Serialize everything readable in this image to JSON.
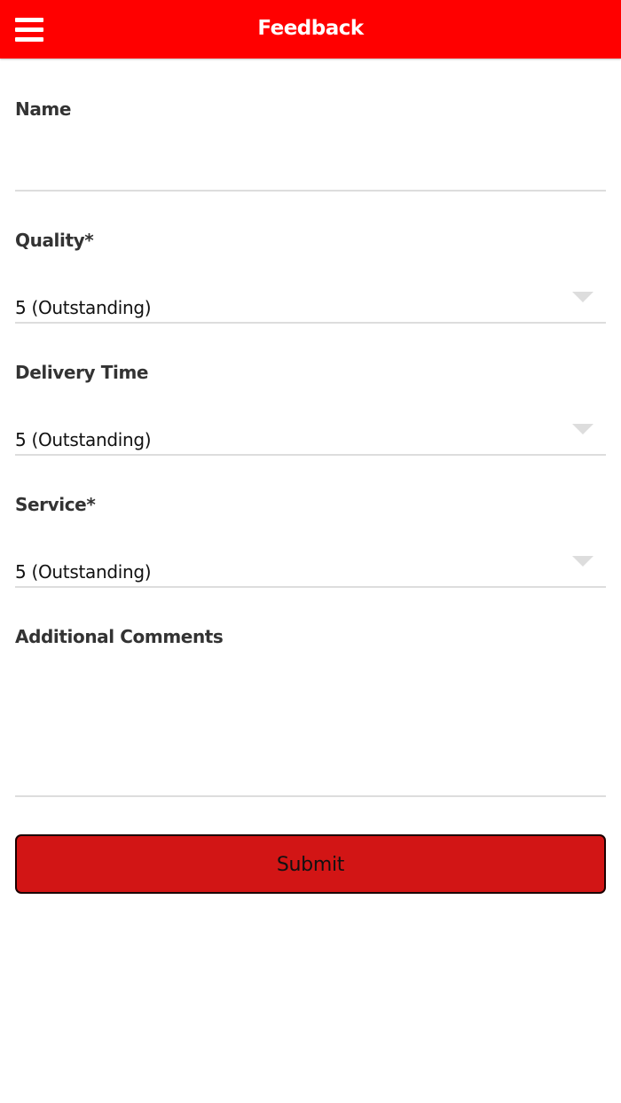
{
  "colors": {
    "header_bg": "#ff0000",
    "header_text": "#ffffff",
    "button_bg": "#d21515",
    "underline": "#dddddd"
  },
  "header": {
    "title": "Feedback",
    "menu_icon": "hamburger-menu-icon"
  },
  "form": {
    "name": {
      "label": "Name",
      "value": ""
    },
    "quality": {
      "label": "Quality*",
      "value": "5 (Outstanding)",
      "icon": "dropdown-caret-icon"
    },
    "delivery_time": {
      "label": "Delivery Time",
      "value": "5 (Outstanding)",
      "icon": "dropdown-caret-icon"
    },
    "service": {
      "label": "Service*",
      "value": "5 (Outstanding)",
      "icon": "dropdown-caret-icon"
    },
    "comments": {
      "label": "Additional Comments",
      "value": ""
    },
    "submit_label": "Submit"
  }
}
